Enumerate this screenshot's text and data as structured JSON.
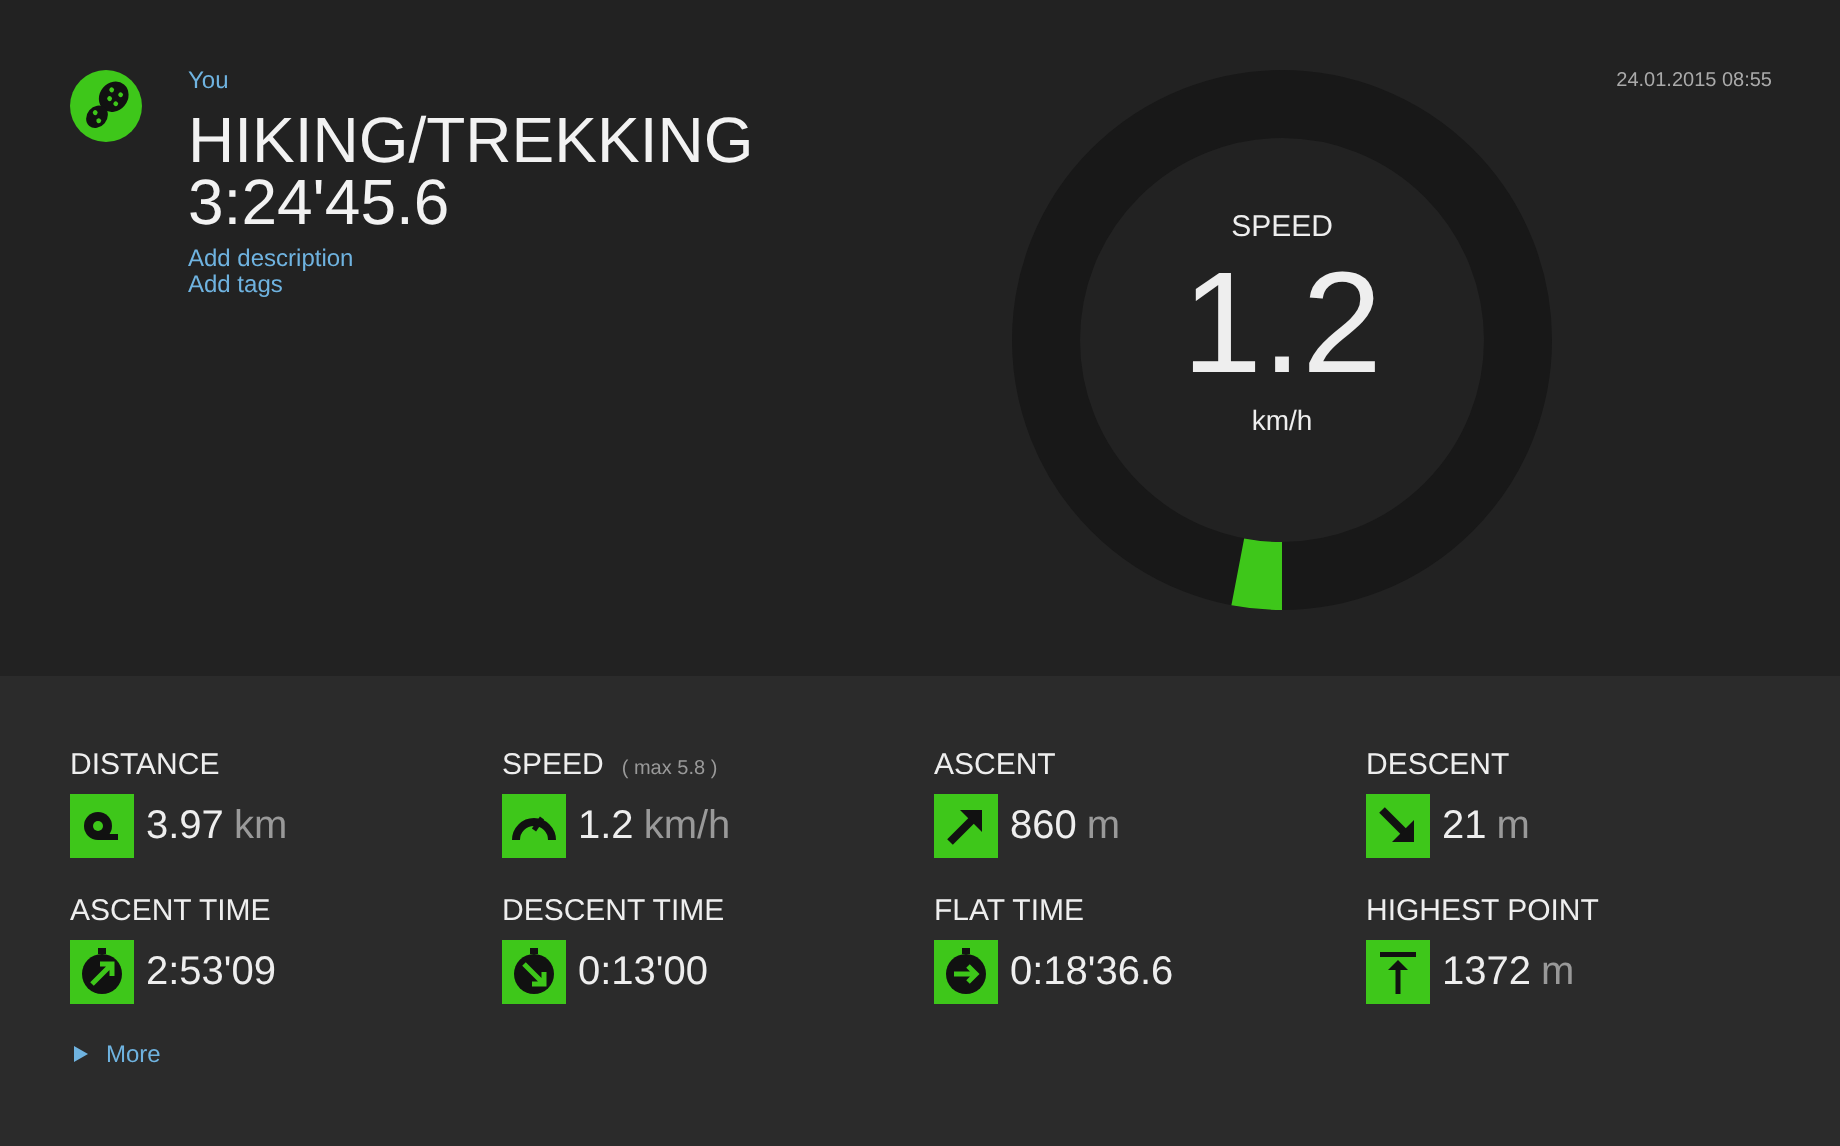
{
  "header": {
    "user": "You",
    "activity": "HIKING/TREKKING",
    "duration": "3:24'45.6",
    "links": [
      "Add description",
      "Add tags"
    ],
    "date": "24.01.2015 08:55"
  },
  "gauge": {
    "label": "SPEED",
    "value": "1.2",
    "unit": "km/h",
    "level": 0.03
  },
  "stats": [
    {
      "kind": "distance",
      "label": "DISTANCE",
      "value": "3.97",
      "unit": "km"
    },
    {
      "kind": "speed",
      "label": "SPEED",
      "note": "( max 5.8 )",
      "value": "1.2",
      "unit": "km/h"
    },
    {
      "kind": "ascent",
      "label": "ASCENT",
      "value": "860",
      "unit": "m"
    },
    {
      "kind": "descent",
      "label": "DESCENT",
      "value": "21",
      "unit": "m"
    },
    {
      "kind": "ascent_time",
      "label": "ASCENT TIME",
      "value": "2:53'09"
    },
    {
      "kind": "descent_time",
      "label": "DESCENT TIME",
      "value": "0:13'00"
    },
    {
      "kind": "flat_time",
      "label": "FLAT TIME",
      "value": "0:18'36.6"
    },
    {
      "kind": "highest",
      "label": "HIGHEST POINT",
      "value": "1372",
      "unit": "m"
    }
  ],
  "more": {
    "label": "More",
    "expanded": false
  }
}
